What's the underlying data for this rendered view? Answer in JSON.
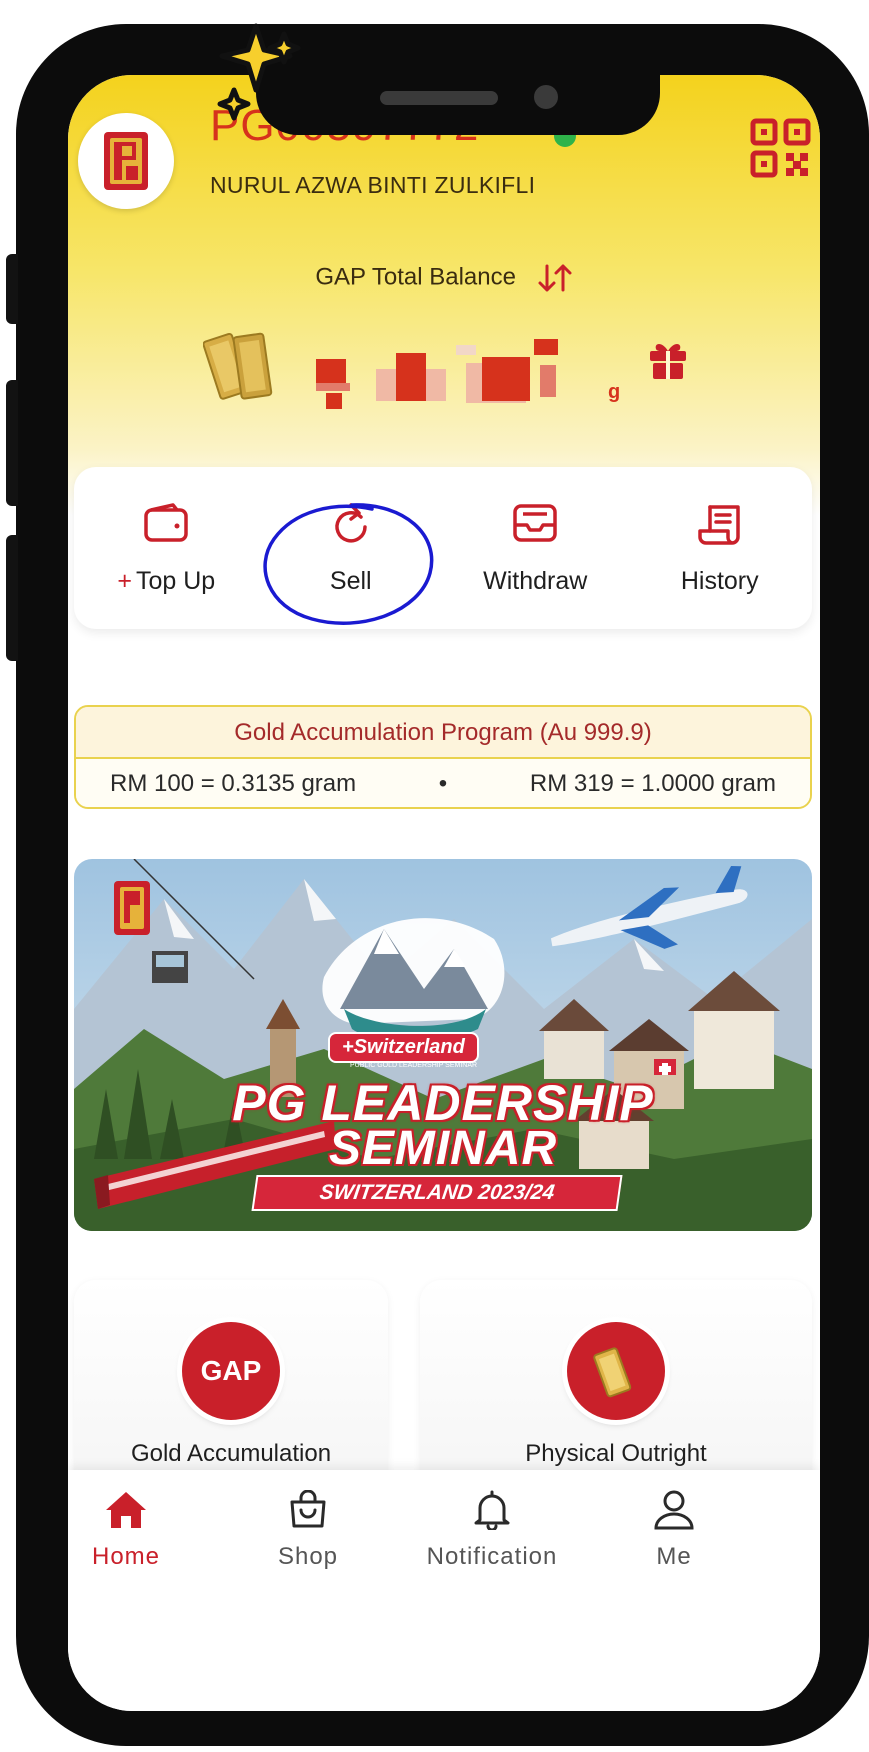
{
  "header": {
    "member_id": "PG00597772",
    "member_name": "NURUL AZWA BINTI ZULKIFLI",
    "balance_label": "GAP Total Balance",
    "balance_unit": "g"
  },
  "actions": {
    "top_up_plus": "+",
    "top_up": "Top Up",
    "sell": "Sell",
    "withdraw": "Withdraw",
    "history": "History"
  },
  "program": {
    "title": "Gold Accumulation Program (Au 999.9)",
    "rate_left": "RM 100 = 0.3135 gram",
    "separator": "•",
    "rate_right": "RM 319 = 1.0000 gram"
  },
  "banner": {
    "tag": "+Switzerland",
    "tag_sub": "PUBLIC GOLD LEADERSHIP SEMINAR",
    "line1": "PG LEADERSHIP",
    "line2": "SEMINAR",
    "line3": "SWITZERLAND 2023/24"
  },
  "products": {
    "gap_badge": "GAP",
    "gap_label": "Gold Accumulation",
    "physical_label": "Physical Outright"
  },
  "nav": {
    "home": "Home",
    "shop": "Shop",
    "notification": "Notification",
    "me": "Me"
  },
  "colors": {
    "accent_red": "#c9202a",
    "header_yellow": "#f4d21d",
    "annotation_blue": "#1a1ad1"
  }
}
